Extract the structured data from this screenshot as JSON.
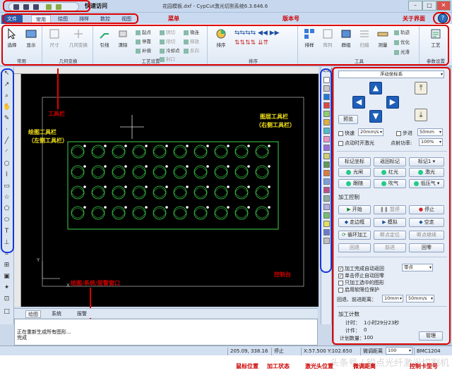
{
  "app": {
    "window_title": "花园模板.dxf - CypCut激光切割系统6.3.646.6",
    "quick_access_label": "快速访问"
  },
  "menu": {
    "tabs": [
      "文件",
      "常用",
      "绘图",
      "排样",
      "数控",
      "视图"
    ],
    "active_tab": "常用"
  },
  "ribbon": {
    "groups": [
      {
        "label": "常用",
        "buttons": [
          "选择",
          "显示"
        ]
      },
      {
        "label": "几何变换",
        "buttons": [
          "尺寸",
          "几何变换"
        ]
      },
      {
        "label": "工艺设置",
        "buttons": [
          "引线",
          "清除"
        ],
        "small": [
          "起点",
          "阴切",
          "微连",
          "停靠",
          "阳切",
          "释放",
          "补偿",
          "冷却点",
          "封口",
          "反向",
          "分离"
        ]
      },
      {
        "label": "排序",
        "buttons": [
          "排序"
        ]
      },
      {
        "label": "工具",
        "buttons": [
          "排样",
          "阵列",
          "群组",
          "扫描",
          "测量"
        ],
        "small": [
          "轨迹",
          "优化",
          "光滑"
        ]
      },
      {
        "label": "参数设置",
        "buttons": [
          "工艺"
        ]
      }
    ]
  },
  "left_tools": [
    "select-arrow",
    "node-edit",
    "zoom",
    "pan",
    "pencil",
    "line",
    "arc",
    "circle",
    "polyline",
    "rectangle",
    "star",
    "ellipse",
    "text",
    "measure",
    "crop",
    "insert",
    "table",
    "fill",
    "paint",
    "crop-box",
    "note"
  ],
  "layer_colors": [
    "#ffffff",
    "#c8c8c8",
    "#1f78e0",
    "#e04646",
    "#8cd06a",
    "#e3b03c",
    "#46c0d0",
    "#f090c8",
    "#9c6de0",
    "#d0d070",
    "#5a9b5a",
    "#e07a3a",
    "#7aa0e0",
    "#c04c8c",
    "#8ab0a0",
    "#b0b0e0",
    "#70c070",
    "#e0e060",
    "#6a7ad0",
    "#c0c0c0"
  ],
  "layer_top_label": "1/2/3",
  "canvas": {
    "background": "#000000",
    "shape_color": "#3ed24a",
    "origin_x_label": "X",
    "origin_y_label": "Y"
  },
  "bottom_tabs": [
    "绘图",
    "系统",
    "报警"
  ],
  "log_lines": [
    "正在重新生成所有图形...",
    "完成"
  ],
  "control": {
    "coordinate_mode": "浮动坐标系",
    "preview_button": "预览",
    "fast_label": "快速",
    "fast_speed": "20mm/s",
    "step_label": "步进",
    "step_size": "50mm",
    "laser_on_label": "点动时开激光",
    "spot_power_label": "点射功率:",
    "spot_power": "100%",
    "row1": [
      "标记坐标",
      "返回标记",
      "标记1"
    ],
    "row2": [
      "光闸",
      "红光",
      "激光"
    ],
    "row3": [
      "跟随",
      "吹气",
      "低压气"
    ],
    "machining_title": "加工控制",
    "start": "开始",
    "pause": "暂停",
    "stop": "停止",
    "frame": "走边框",
    "simulate": "模拟",
    "dry_run": "空走",
    "loop": "循环加工",
    "breakpoint_locate": "断点定位",
    "breakpoint_resume": "断点继续",
    "back": "回退",
    "forward": "前进",
    "return_zero": "回零",
    "return_point": "零点",
    "auto_return": "加工完成自动返回",
    "stop_return": "单击停止自动回零",
    "only_selected": "只加工选中的图形",
    "soft_limit": "启用软限位保护",
    "back_distance_label": "回退、前进距离：",
    "back_distance": "10mm",
    "back_speed": "50mm/s",
    "counter_title": "加工计数",
    "timer_label": "计时：",
    "timer_value": "1小时29分23秒",
    "parts_label": "计件：",
    "parts_value": "0",
    "planned_label": "计划数量：",
    "planned_value": "100",
    "manage": "管理"
  },
  "status_bar": {
    "mouse_position": "205.09, 338.16",
    "machine_state": "停止",
    "laser_position": "X:57.500 Y:102.650",
    "fine_label": "微调距离",
    "fine_value": "100",
    "card_model": "BMC1204"
  },
  "annotations": {
    "quick_access": "快速访问",
    "menu": "菜单",
    "version": "版本号",
    "about": "关于界面",
    "toolbar": "工具栏",
    "left_toolbar_1": "绘图工具栏",
    "left_toolbar_2": "（左侧工具栏）",
    "right_toolbar_1": "图层工具栏",
    "right_toolbar_2": "（右侧工具栏）",
    "console": "控制台",
    "drawing_window": "绘图/系统/报警窗口",
    "mouse_position": "鼠标位置",
    "machine_state": "加工状态",
    "laser_position": "激光头位置",
    "fine_distance": "微调距离",
    "card_model": "控制卡型号"
  },
  "watermark": "头条号 / 锐点光纤激光切割机",
  "accent_color": "#dd0000",
  "annotation_box_color": "#1438d8"
}
